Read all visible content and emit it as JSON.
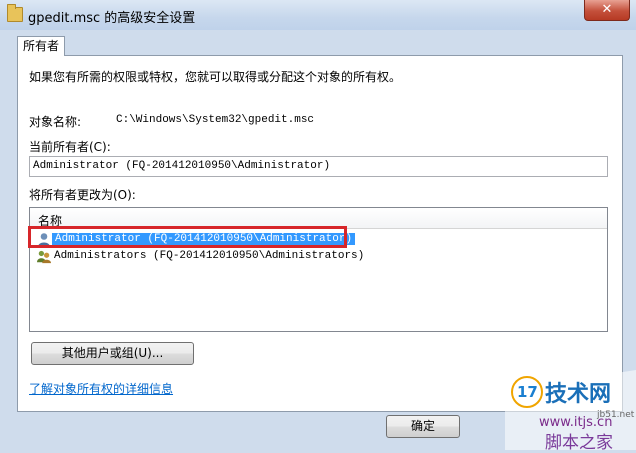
{
  "window": {
    "title": "gpedit.msc 的高级安全设置",
    "close_glyph": "✕"
  },
  "tabs": [
    {
      "label": "所有者"
    }
  ],
  "content": {
    "intro": "如果您有所需的权限或特权，您就可以取得或分配这个对象的所有权。",
    "object_name_label": "对象名称:",
    "object_name_value": "C:\\Windows\\System32\\gpedit.msc",
    "current_owner_label": "当前所有者(C):",
    "current_owner_value": "Administrator (FQ-201412010950\\Administrator)",
    "change_owner_label": "将所有者更改为(O):",
    "list_header": "名称",
    "owners": [
      {
        "name": "Administrator (FQ-201412010950\\Administrator)",
        "selected": true,
        "icon": "user-icon"
      },
      {
        "name": "Administrators (FQ-201412010950\\Administrators)",
        "selected": false,
        "icon": "group-icon"
      }
    ],
    "other_users_button": "其他用户或组(U)...",
    "learn_more_link": "了解对象所有权的详细信息"
  },
  "footer": {
    "ok_button": "确定"
  },
  "watermark": {
    "brand_number": "17",
    "brand_name": "技术网",
    "url_small": "jb51.net",
    "url": "www.itjs.cn",
    "site_name": "脚本之家"
  },
  "colors": {
    "selection": "#3399ff",
    "highlight_border": "#d7262a",
    "link": "#0066cc"
  }
}
